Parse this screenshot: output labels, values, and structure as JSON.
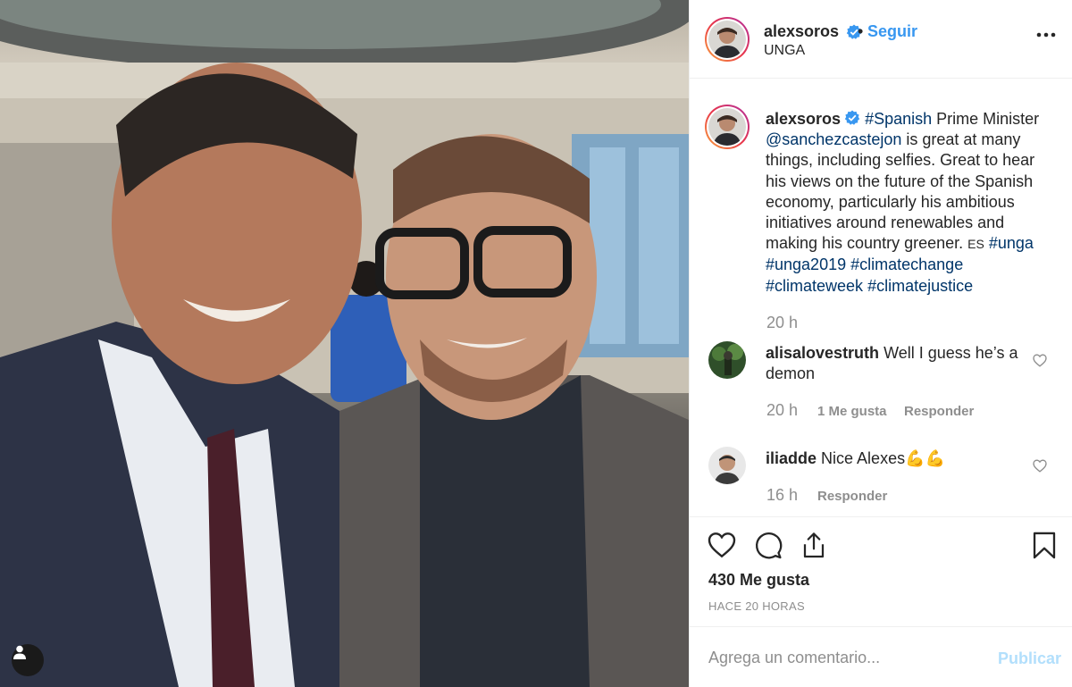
{
  "post": {
    "username": "alexsoros",
    "follow_label": "Seguir",
    "separator": "•",
    "location": "UNGA"
  },
  "caption": {
    "username": "alexsoros",
    "parts": {
      "tag_spanish": "#Spanish",
      "text1": " Prime Minister ",
      "mention": "@sanchezcastejon",
      "text2": " is great at many things, including selfies. Great to hear his views on the future of the Spanish economy, particularly his ambitious initiatives around renewables and making his country greener. ",
      "flag": "ES",
      "tag_unga": "#unga",
      "tag_unga2019": "#unga2019",
      "tag_climatechange": "#climatechange",
      "tag_climateweek": "#climateweek",
      "tag_climatejustice": "#climatejustice"
    },
    "time": "20 h"
  },
  "comments": [
    {
      "username": "alisalovestruth",
      "text": "Well I guess he’s a demon",
      "time": "20 h",
      "likes": "1 Me gusta",
      "reply": "Responder"
    },
    {
      "username": "iliadde",
      "text": "Nice Alexes💪💪",
      "time": "16 h",
      "reply": "Responder"
    }
  ],
  "footer": {
    "likes": "430 Me gusta",
    "ago": "HACE 20 HORAS",
    "comment_placeholder": "Agrega un comentario...",
    "publish_label": "Publicar"
  },
  "colors": {
    "link": "#3897f0",
    "hashtag": "#003569",
    "muted": "#8e8e8e",
    "publish_disabled": "#b2dffc"
  },
  "icons": {
    "verified": "verified-badge-icon",
    "more": "more-options-icon",
    "like": "heart-icon",
    "comment": "comment-icon",
    "share": "share-icon",
    "save": "bookmark-icon",
    "tag": "user-tag-icon"
  }
}
